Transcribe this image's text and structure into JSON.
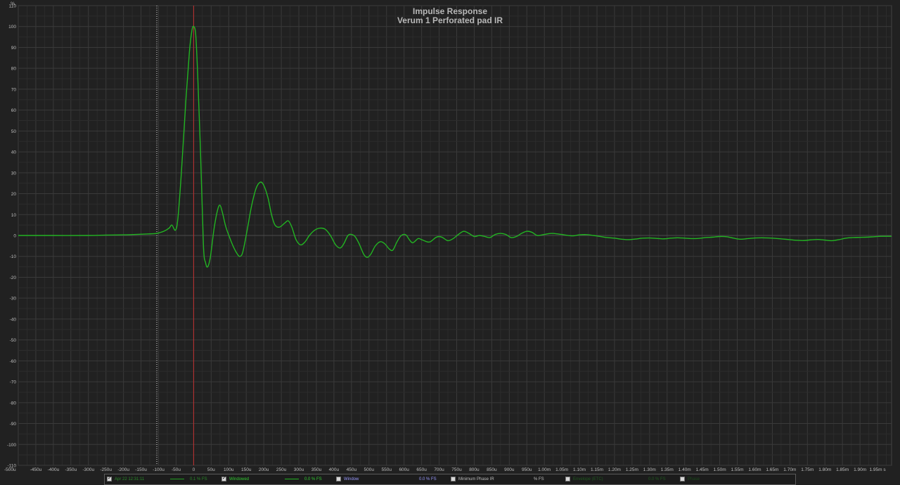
{
  "chart_data": {
    "type": "line",
    "title": "Impulse Response",
    "subtitle": "Verum 1 Perforated pad IR",
    "ylabel": "%",
    "ylim": [
      -110,
      110
    ],
    "yticks": [
      110,
      100,
      90,
      80,
      70,
      60,
      50,
      40,
      30,
      20,
      10,
      0,
      -10,
      -20,
      -30,
      -40,
      -50,
      -60,
      -70,
      -80,
      -90,
      -100,
      -110
    ],
    "xlim_us": [
      -500,
      1990
    ],
    "xticks": [
      {
        "v": -500,
        "label": "-500u"
      },
      {
        "v": -450,
        "label": "-450u"
      },
      {
        "v": -400,
        "label": "-400u"
      },
      {
        "v": -350,
        "label": "-350u"
      },
      {
        "v": -300,
        "label": "-300u"
      },
      {
        "v": -250,
        "label": "-250u"
      },
      {
        "v": -200,
        "label": "-200u"
      },
      {
        "v": -150,
        "label": "-150u"
      },
      {
        "v": -100,
        "label": "-100u"
      },
      {
        "v": -50,
        "label": "-50u"
      },
      {
        "v": 0,
        "label": "0"
      },
      {
        "v": 50,
        "label": "50u"
      },
      {
        "v": 100,
        "label": "100u"
      },
      {
        "v": 150,
        "label": "150u"
      },
      {
        "v": 200,
        "label": "200u"
      },
      {
        "v": 250,
        "label": "250u"
      },
      {
        "v": 300,
        "label": "300u"
      },
      {
        "v": 350,
        "label": "350u"
      },
      {
        "v": 400,
        "label": "400u"
      },
      {
        "v": 450,
        "label": "450u"
      },
      {
        "v": 500,
        "label": "500u"
      },
      {
        "v": 550,
        "label": "550u"
      },
      {
        "v": 600,
        "label": "600u"
      },
      {
        "v": 650,
        "label": "650u"
      },
      {
        "v": 700,
        "label": "700u"
      },
      {
        "v": 750,
        "label": "750u"
      },
      {
        "v": 800,
        "label": "800u"
      },
      {
        "v": 850,
        "label": "850u"
      },
      {
        "v": 900,
        "label": "900u"
      },
      {
        "v": 950,
        "label": "950u"
      },
      {
        "v": 1000,
        "label": "1.00m"
      },
      {
        "v": 1050,
        "label": "1.05m"
      },
      {
        "v": 1100,
        "label": "1.10m"
      },
      {
        "v": 1150,
        "label": "1.15m"
      },
      {
        "v": 1200,
        "label": "1.20m"
      },
      {
        "v": 1250,
        "label": "1.25m"
      },
      {
        "v": 1300,
        "label": "1.30m"
      },
      {
        "v": 1350,
        "label": "1.35m"
      },
      {
        "v": 1400,
        "label": "1.40m"
      },
      {
        "v": 1450,
        "label": "1.45m"
      },
      {
        "v": 1500,
        "label": "1.50m"
      },
      {
        "v": 1550,
        "label": "1.55m"
      },
      {
        "v": 1600,
        "label": "1.60m"
      },
      {
        "v": 1650,
        "label": "1.65m"
      },
      {
        "v": 1700,
        "label": "1.70m"
      },
      {
        "v": 1750,
        "label": "1.75m"
      },
      {
        "v": 1800,
        "label": "1.80m"
      },
      {
        "v": 1850,
        "label": "1.85m"
      },
      {
        "v": 1900,
        "label": "1.90m"
      },
      {
        "v": 1950,
        "label": "1.95m s"
      }
    ],
    "grid": true,
    "markers": [
      {
        "x": -105,
        "color": "#e0e0e0",
        "style": "dotted"
      },
      {
        "x": 0,
        "color": "#c03030",
        "style": "solid"
      }
    ],
    "series": [
      {
        "color": "#22b422",
        "points": [
          [
            -500,
            0
          ],
          [
            -400,
            0
          ],
          [
            -300,
            0
          ],
          [
            -250,
            0.2
          ],
          [
            -200,
            0.3
          ],
          [
            -150,
            0.6
          ],
          [
            -110,
            0.9
          ],
          [
            -100,
            1.2
          ],
          [
            -85,
            2
          ],
          [
            -70,
            3.5
          ],
          [
            -62,
            5
          ],
          [
            -52,
            2.5
          ],
          [
            -45,
            8
          ],
          [
            -35,
            30
          ],
          [
            -22,
            65
          ],
          [
            -12,
            88
          ],
          [
            -5,
            98
          ],
          [
            0,
            100
          ],
          [
            6,
            96
          ],
          [
            12,
            75
          ],
          [
            20,
            38
          ],
          [
            28,
            -5
          ],
          [
            34,
            -13
          ],
          [
            40,
            -15
          ],
          [
            48,
            -10
          ],
          [
            58,
            3
          ],
          [
            68,
            12
          ],
          [
            75,
            14.5
          ],
          [
            82,
            11
          ],
          [
            92,
            4
          ],
          [
            105,
            -2
          ],
          [
            115,
            -6
          ],
          [
            125,
            -9
          ],
          [
            132,
            -10
          ],
          [
            140,
            -8
          ],
          [
            152,
            2
          ],
          [
            165,
            14
          ],
          [
            178,
            22.5
          ],
          [
            190,
            25.5
          ],
          [
            200,
            24
          ],
          [
            212,
            18
          ],
          [
            222,
            10
          ],
          [
            232,
            5
          ],
          [
            245,
            4
          ],
          [
            260,
            6
          ],
          [
            270,
            7
          ],
          [
            280,
            4
          ],
          [
            292,
            -2
          ],
          [
            305,
            -4.5
          ],
          [
            318,
            -3
          ],
          [
            330,
            0
          ],
          [
            345,
            2.5
          ],
          [
            360,
            3.5
          ],
          [
            375,
            3
          ],
          [
            390,
            0
          ],
          [
            405,
            -4.5
          ],
          [
            418,
            -6
          ],
          [
            428,
            -4
          ],
          [
            440,
            0
          ],
          [
            450,
            0.5
          ],
          [
            460,
            -0.5
          ],
          [
            472,
            -4
          ],
          [
            485,
            -9
          ],
          [
            495,
            -10.5
          ],
          [
            505,
            -9
          ],
          [
            518,
            -5
          ],
          [
            532,
            -3
          ],
          [
            545,
            -4
          ],
          [
            558,
            -6.5
          ],
          [
            568,
            -7
          ],
          [
            580,
            -3
          ],
          [
            592,
            0
          ],
          [
            605,
            0.3
          ],
          [
            615,
            -2
          ],
          [
            625,
            -3.5
          ],
          [
            640,
            -1.5
          ],
          [
            650,
            -2
          ],
          [
            665,
            -3
          ],
          [
            675,
            -3
          ],
          [
            690,
            -1
          ],
          [
            700,
            -0.5
          ],
          [
            710,
            -1
          ],
          [
            725,
            -2.5
          ],
          [
            740,
            -1.5
          ],
          [
            755,
            0.5
          ],
          [
            770,
            2
          ],
          [
            785,
            1
          ],
          [
            800,
            -0.5
          ],
          [
            815,
            0
          ],
          [
            830,
            -0.5
          ],
          [
            845,
            -1
          ],
          [
            860,
            0.5
          ],
          [
            875,
            1
          ],
          [
            890,
            0.5
          ],
          [
            905,
            -1
          ],
          [
            920,
            -0.5
          ],
          [
            935,
            1
          ],
          [
            950,
            2
          ],
          [
            965,
            1.5
          ],
          [
            980,
            0
          ],
          [
            1000,
            0.5
          ],
          [
            1020,
            1
          ],
          [
            1040,
            0.7
          ],
          [
            1060,
            0.2
          ],
          [
            1080,
            -0.2
          ],
          [
            1100,
            0.3
          ],
          [
            1120,
            0.4
          ],
          [
            1140,
            0
          ],
          [
            1160,
            -0.5
          ],
          [
            1180,
            -1
          ],
          [
            1200,
            -1.3
          ],
          [
            1220,
            -1.8
          ],
          [
            1240,
            -2
          ],
          [
            1260,
            -1.7
          ],
          [
            1280,
            -1.3
          ],
          [
            1300,
            -1.2
          ],
          [
            1320,
            -1.4
          ],
          [
            1340,
            -1.6
          ],
          [
            1360,
            -1.3
          ],
          [
            1380,
            -1.1
          ],
          [
            1400,
            -1.3
          ],
          [
            1420,
            -1.5
          ],
          [
            1440,
            -1.4
          ],
          [
            1460,
            -1
          ],
          [
            1480,
            -0.8
          ],
          [
            1500,
            -0.5
          ],
          [
            1520,
            -0.6
          ],
          [
            1540,
            -1.3
          ],
          [
            1560,
            -1.8
          ],
          [
            1580,
            -1.5
          ],
          [
            1600,
            -1.2
          ],
          [
            1620,
            -1.1
          ],
          [
            1640,
            -1.2
          ],
          [
            1660,
            -1.4
          ],
          [
            1680,
            -1.7
          ],
          [
            1700,
            -2
          ],
          [
            1720,
            -2.3
          ],
          [
            1740,
            -2.4
          ],
          [
            1760,
            -2.1
          ],
          [
            1780,
            -1.9
          ],
          [
            1800,
            -2.2
          ],
          [
            1820,
            -2.5
          ],
          [
            1840,
            -2
          ],
          [
            1860,
            -1.3
          ],
          [
            1880,
            -1
          ],
          [
            1900,
            -0.9
          ],
          [
            1920,
            -0.8
          ],
          [
            1940,
            -0.6
          ],
          [
            1960,
            -0.4
          ],
          [
            1990,
            -0.4
          ]
        ]
      }
    ]
  },
  "legend": {
    "items": [
      {
        "check": true,
        "name": "Apr 22 12:31:11",
        "value": "0.1 % FS",
        "color": "#22a022",
        "name_color": "#2a8a2a",
        "value_color": "#2a8a2a",
        "line": true
      },
      {
        "check": true,
        "name": "Windowed",
        "value": "0.0 % FS",
        "color": "#22b422",
        "name_color": "#33cc33",
        "value_color": "#33cc33",
        "line": true
      },
      {
        "check": false,
        "name": "Window",
        "value": "0.0 % FS",
        "color": "#9a9aff",
        "name_color": "#9a9aff",
        "value_color": "#9a9aff",
        "line": false
      },
      {
        "check": false,
        "name": "Minimum Phase IR",
        "value": "% FS",
        "color": "#c0c0c0",
        "name_color": "#bdbdbd",
        "value_color": "#bdbdbd",
        "line": false
      },
      {
        "check": false,
        "name": "Envelope (ETC)",
        "value": "0.0 % FS",
        "color": "#1f5a1f",
        "name_color": "#1f5a1f",
        "value_color": "#1f5a1f",
        "line": false
      },
      {
        "check": false,
        "name": "Phase",
        "value": "",
        "color": "#1f5a1f",
        "name_color": "#1a4a1a",
        "value_color": "#1a4a1a",
        "line": false
      }
    ]
  }
}
